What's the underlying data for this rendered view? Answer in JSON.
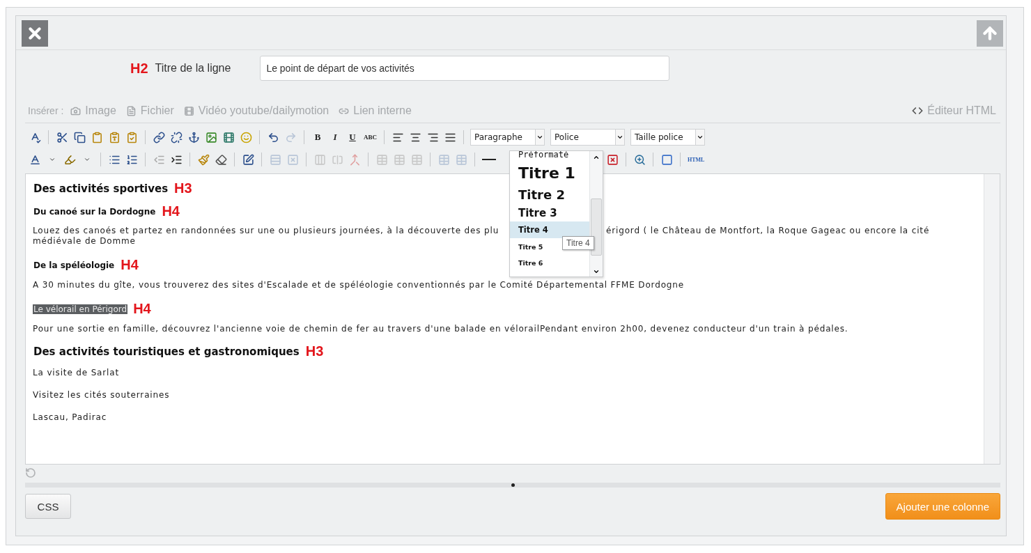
{
  "title_row": {
    "marker": "H2",
    "label": "Titre de la ligne",
    "value": "Le point de départ de vos activités"
  },
  "insert": {
    "label": "Insérer :",
    "links": [
      "Image",
      "Fichier",
      "Vidéo youtube/dailymotion",
      "Lien interne"
    ],
    "html_editor": "Éditeur HTML"
  },
  "toolbar": {
    "format_buttons": [
      "B",
      "I",
      "U",
      "ABC"
    ],
    "selects": [
      "Paragraphe",
      "Police",
      "Taille police"
    ],
    "html_button": "HTML"
  },
  "format_dropdown": {
    "items": [
      {
        "label": "Préformaté",
        "selected": false
      },
      {
        "label": "Titre 1",
        "selected": false
      },
      {
        "label": "Titre 2",
        "selected": false
      },
      {
        "label": "Titre 3",
        "selected": false
      },
      {
        "label": "Titre 4",
        "selected": true
      },
      {
        "label": "Titre 5",
        "selected": false
      },
      {
        "label": "Titre 6",
        "selected": false
      }
    ],
    "tooltip": "Titre 4"
  },
  "content": [
    {
      "kind": "h3",
      "text": "Des activités sportives",
      "marker": "H3",
      "selected": false
    },
    {
      "kind": "h4",
      "text": "Du canoé sur la Dordogne",
      "marker": "H4",
      "selected": false
    },
    {
      "kind": "split",
      "left": "Louez des canoés et partez en randonnées sur une ou plusieurs journées, à la découverte des plu",
      "right": "érigord ( le Château de Montfort, la Roque Gageac ou encore la cité",
      "rest": "médiévale de Domme"
    },
    {
      "kind": "h4",
      "text": "De la spéléologie",
      "marker": "H4",
      "selected": false
    },
    {
      "kind": "p",
      "text": "A 30 minutes du gîte, vous trouverez des sites d'Escalade et de spéléologie conventionnés par le Comité Départemental FFME Dordogne"
    },
    {
      "kind": "h4",
      "text": "Le vélorail en Périgord",
      "marker": "H4",
      "selected": true
    },
    {
      "kind": "p",
      "text": "Pour une sortie en famille, découvrez l'ancienne voie de chemin de fer au travers d'une balade en vélorailPendant environ 2h00, devenez conducteur d'un train à pédales."
    },
    {
      "kind": "h3",
      "text": "Des activités touristiques et gastronomiques",
      "marker": "H3",
      "selected": false
    },
    {
      "kind": "p",
      "text": "La visite de Sarlat"
    },
    {
      "kind": "p",
      "text": "Visitez les cités souterraines"
    },
    {
      "kind": "p",
      "text": "Lascau, Padirac"
    }
  ],
  "buttons": {
    "css": "CSS",
    "add_column": "Ajouter une colonne"
  }
}
